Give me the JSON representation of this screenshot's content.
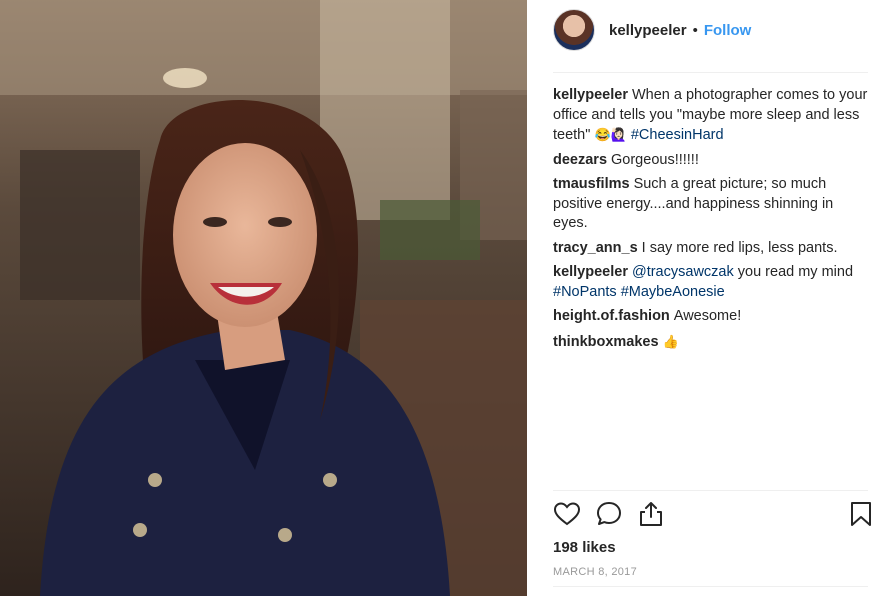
{
  "post": {
    "username": "kellypeeler",
    "separator": "•",
    "follow_label": "Follow",
    "photo_icon": "portrait-photo"
  },
  "comments": [
    {
      "user": "kellypeeler",
      "text": "When a photographer comes to your office and tells you \"maybe more sleep and less teeth\" ",
      "emoji": "😂🙋🏻‍♀️",
      "tags": [
        "#CheesinHard"
      ]
    },
    {
      "user": "deezars",
      "text": "Gorgeous!!!!!!"
    },
    {
      "user": "tmausfilms",
      "text": "Such a great picture; so much positive energy....and happiness shinning in eyes."
    },
    {
      "user": "tracy_ann_s",
      "text": "I say more red lips, less pants."
    },
    {
      "user": "kellypeeler",
      "mention": "@tracysawczak",
      "text": " you read my mind ",
      "tags": [
        "#NoPants",
        "#MaybeAonesie"
      ]
    },
    {
      "user": "height.of.fashion",
      "text": "Awesome!"
    },
    {
      "user": "thinkboxmakes",
      "emoji": "👍"
    }
  ],
  "actions": {
    "like_icon": "heart-icon",
    "comment_icon": "comment-icon",
    "share_icon": "share-icon",
    "save_icon": "bookmark-icon"
  },
  "likes_text": "198 likes",
  "date_text": "MARCH 8, 2017",
  "colors": {
    "link": "#003569",
    "follow": "#3897f0",
    "text": "#262626",
    "muted": "#999999"
  }
}
